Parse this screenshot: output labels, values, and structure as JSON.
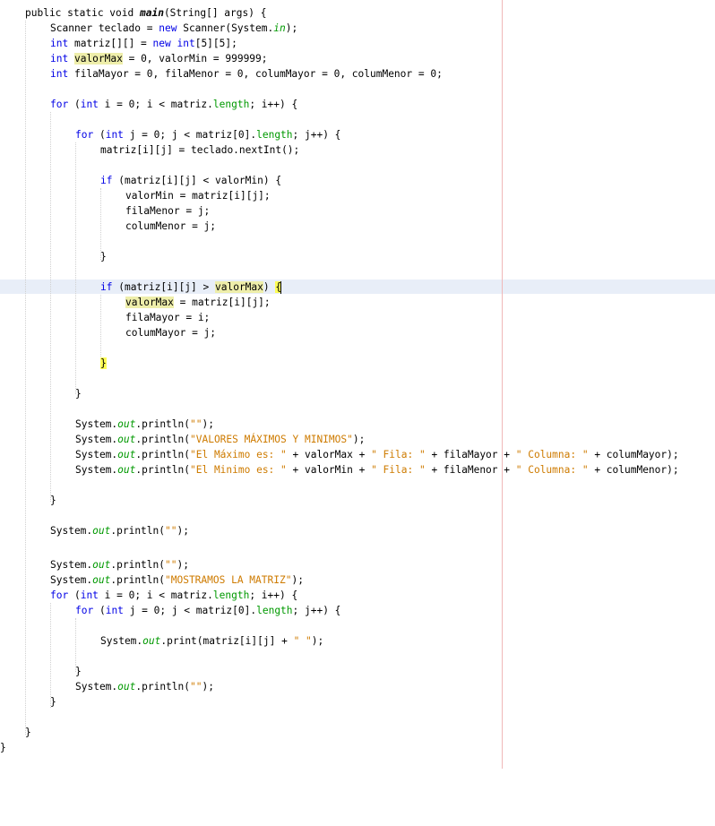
{
  "editor": {
    "lines": [
      [
        {
          "t": "public static void "
        },
        {
          "t": "main",
          "c": "mname"
        },
        {
          "t": "(String[] args) {"
        }
      ],
      [
        {
          "t": "Scanner teclado = "
        },
        {
          "t": "new",
          "c": "kw"
        },
        {
          "t": " Scanner(System."
        },
        {
          "t": "in",
          "c": "sfld"
        },
        {
          "t": ");"
        }
      ],
      [
        {
          "t": "int",
          "c": "kw"
        },
        {
          "t": " matriz[][] = "
        },
        {
          "t": "new",
          "c": "kw"
        },
        {
          "t": " "
        },
        {
          "t": "int",
          "c": "kw"
        },
        {
          "t": "[5][5];"
        }
      ],
      [
        {
          "t": "int",
          "c": "kw"
        },
        {
          "t": " "
        },
        {
          "t": "valorMax",
          "c": "occ"
        },
        {
          "t": " = 0, valorMin = 999999;"
        }
      ],
      [
        {
          "t": "int",
          "c": "kw"
        },
        {
          "t": " filaMayor = 0, filaMenor = 0, columMayor = 0, columMenor = 0;"
        }
      ],
      [
        {
          "t": "for",
          "c": "kw"
        },
        {
          "t": " ("
        },
        {
          "t": "int",
          "c": "kw"
        },
        {
          "t": " i = 0; i < matriz."
        },
        {
          "t": "length",
          "c": "fld"
        },
        {
          "t": "; i++) {"
        }
      ],
      [
        {
          "t": "for",
          "c": "kw"
        },
        {
          "t": " ("
        },
        {
          "t": "int",
          "c": "kw"
        },
        {
          "t": " j = 0; j < matriz[0]."
        },
        {
          "t": "length",
          "c": "fld"
        },
        {
          "t": "; j++) {"
        }
      ],
      [
        {
          "t": "matriz[i][j] = teclado.nextInt();"
        }
      ],
      [
        {
          "t": "if",
          "c": "kw"
        },
        {
          "t": " (matriz[i][j] < valorMin) {"
        }
      ],
      [
        {
          "t": "valorMin = matriz[i][j];"
        }
      ],
      [
        {
          "t": "filaMenor = j;"
        }
      ],
      [
        {
          "t": "columMenor = j;"
        }
      ],
      [
        {
          "t": "}"
        }
      ],
      [
        {
          "t": "if",
          "c": "kw"
        },
        {
          "t": " (matriz[i][j] > "
        },
        {
          "t": "valorMax",
          "c": "occ"
        },
        {
          "t": ") "
        },
        {
          "t": "{",
          "c": "brace-match"
        }
      ],
      [
        {
          "t": "valorMax",
          "c": "occ"
        },
        {
          "t": " = matriz[i][j];"
        }
      ],
      [
        {
          "t": "filaMayor = i;"
        }
      ],
      [
        {
          "t": "columMayor = j;"
        }
      ],
      [
        {
          "t": "}",
          "c": "brace-match"
        }
      ],
      [
        {
          "t": "}"
        }
      ],
      [
        {
          "t": "System."
        },
        {
          "t": "out",
          "c": "sfld"
        },
        {
          "t": ".println("
        },
        {
          "t": "\"\"",
          "c": "str"
        },
        {
          "t": ");"
        }
      ],
      [
        {
          "t": "System."
        },
        {
          "t": "out",
          "c": "sfld"
        },
        {
          "t": ".println("
        },
        {
          "t": "\"VALORES MÁXIMOS Y MINIMOS\"",
          "c": "str"
        },
        {
          "t": ");"
        }
      ],
      [
        {
          "t": "System."
        },
        {
          "t": "out",
          "c": "sfld"
        },
        {
          "t": ".println("
        },
        {
          "t": "\"El Máximo es: \"",
          "c": "str"
        },
        {
          "t": " + valorMax + "
        },
        {
          "t": "\" Fila: \"",
          "c": "str"
        },
        {
          "t": " + filaMayor + "
        },
        {
          "t": "\" Columna: \"",
          "c": "str"
        },
        {
          "t": " + columMayor);"
        }
      ],
      [
        {
          "t": "System."
        },
        {
          "t": "out",
          "c": "sfld"
        },
        {
          "t": ".println("
        },
        {
          "t": "\"El Minimo es: \"",
          "c": "str"
        },
        {
          "t": " + valorMin + "
        },
        {
          "t": "\" Fila: \"",
          "c": "str"
        },
        {
          "t": " + filaMenor + "
        },
        {
          "t": "\" Columna: \"",
          "c": "str"
        },
        {
          "t": " + columMenor);"
        }
      ],
      [
        {
          "t": "}"
        }
      ],
      [
        {
          "t": "System."
        },
        {
          "t": "out",
          "c": "sfld"
        },
        {
          "t": ".println("
        },
        {
          "t": "\"\"",
          "c": "str"
        },
        {
          "t": ");"
        }
      ],
      [
        {
          "t": "System."
        },
        {
          "t": "out",
          "c": "sfld"
        },
        {
          "t": ".println("
        },
        {
          "t": "\"\"",
          "c": "str"
        },
        {
          "t": ");"
        }
      ],
      [
        {
          "t": "System."
        },
        {
          "t": "out",
          "c": "sfld"
        },
        {
          "t": ".println("
        },
        {
          "t": "\"MOSTRAMOS LA MATRIZ\"",
          "c": "str"
        },
        {
          "t": ");"
        }
      ],
      [
        {
          "t": "for",
          "c": "kw"
        },
        {
          "t": " ("
        },
        {
          "t": "int",
          "c": "kw"
        },
        {
          "t": " i = 0; i < matriz."
        },
        {
          "t": "length",
          "c": "fld"
        },
        {
          "t": "; i++) {"
        }
      ],
      [
        {
          "t": "for",
          "c": "kw"
        },
        {
          "t": " ("
        },
        {
          "t": "int",
          "c": "kw"
        },
        {
          "t": " j = 0; j < matriz[0]."
        },
        {
          "t": "length",
          "c": "fld"
        },
        {
          "t": "; j++) {"
        }
      ],
      [
        {
          "t": "System."
        },
        {
          "t": "out",
          "c": "sfld"
        },
        {
          "t": ".print(matriz[i][j] + "
        },
        {
          "t": "\" \"",
          "c": "str"
        },
        {
          "t": ");"
        }
      ],
      [
        {
          "t": "}"
        }
      ],
      [
        {
          "t": "System."
        },
        {
          "t": "out",
          "c": "sfld"
        },
        {
          "t": ".println("
        },
        {
          "t": "\"\"",
          "c": "str"
        },
        {
          "t": ");"
        }
      ],
      [
        {
          "t": "}"
        }
      ],
      [
        {
          "t": "}"
        }
      ],
      [
        {
          "t": "}"
        }
      ]
    ]
  }
}
